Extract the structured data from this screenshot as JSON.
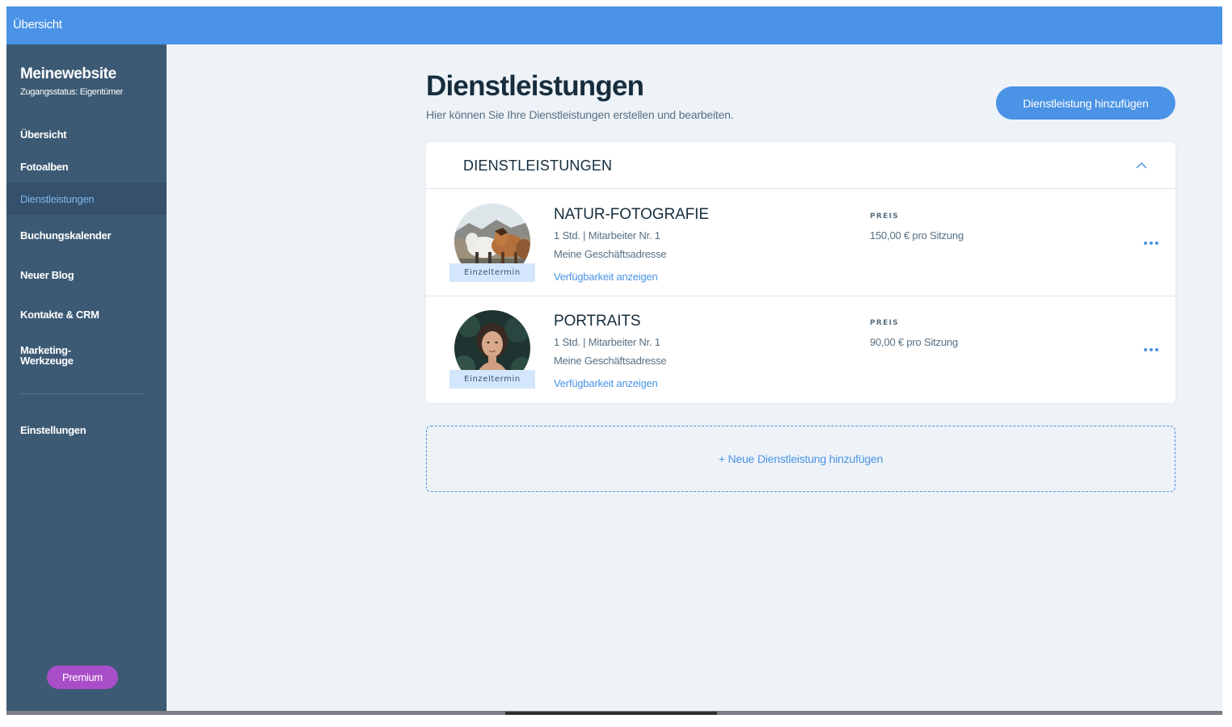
{
  "topbar": {
    "title": "Übersicht"
  },
  "sidebar": {
    "site_name": "Meinewebsite",
    "access_status": "Zugangsstatus: Eigentümer",
    "items": [
      {
        "label": "Übersicht",
        "active": false
      },
      {
        "label": "Fotoalben",
        "active": false
      },
      {
        "label": "Dienstleistungen",
        "active": true
      },
      {
        "label": "Buchungskalender",
        "active": false
      },
      {
        "label": "Neuer Blog",
        "active": false
      },
      {
        "label": "Kontakte & CRM",
        "active": false
      },
      {
        "label_line1": "Marketing-",
        "label_line2": "Werkzeuge",
        "active": false
      },
      {
        "label": "Einstellungen",
        "active": false
      }
    ],
    "premium_label": "Premium"
  },
  "main": {
    "title": "Dienstleistungen",
    "subtitle": "Hier können Sie Ihre Dienstleistungen erstellen und bearbeiten.",
    "add_button_label": "Dienstleistung hinzufügen",
    "card": {
      "header_title": "DIENSTLEISTUNGEN",
      "services": [
        {
          "title": "NATUR-FOTOGRAFIE",
          "meta": "1 Std. | Mitarbeiter Nr. 1",
          "address": "Meine Geschäftsadresse",
          "link": "Verfügbarkeit anzeigen",
          "badge": "Einzeltermin",
          "price_label": "PREIS",
          "price": "150,00 € pro Sitzung",
          "image": "horses-photo"
        },
        {
          "title": "PORTRAITS",
          "meta": "1 Std. | Mitarbeiter Nr. 1",
          "address": "Meine Geschäftsadresse",
          "link": "Verfügbarkeit anzeigen",
          "badge": "Einzeltermin",
          "price_label": "PREIS",
          "price": "90,00 € pro Sitzung",
          "image": "portrait-photo"
        }
      ]
    },
    "add_new_label": "+ Neue Dienstleistung hinzufügen"
  },
  "colors": {
    "accent": "#4a93e6",
    "sidebar": "#3d5a74",
    "premium": "#aa4dc8",
    "background": "#eef3f8"
  }
}
